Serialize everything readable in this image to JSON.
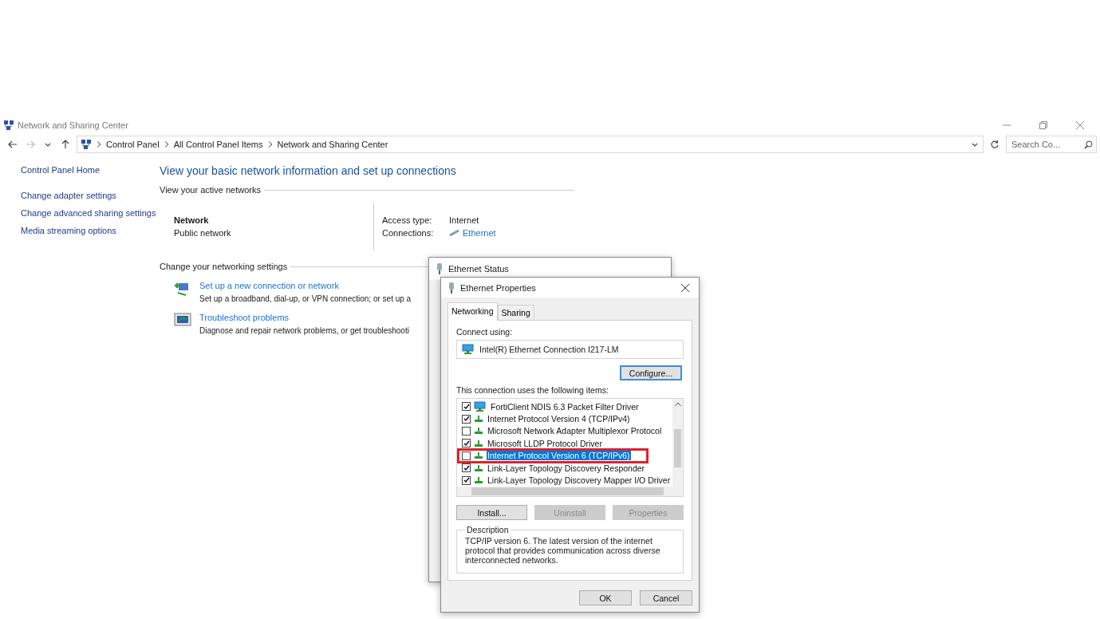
{
  "window": {
    "title": "Network and Sharing Center"
  },
  "address_bar": {
    "breadcrumbs": [
      "Control Panel",
      "All Control Panel Items",
      "Network and Sharing Center"
    ]
  },
  "search": {
    "placeholder": "Search Co..."
  },
  "sidebar": {
    "items": [
      "Control Panel Home",
      "Change adapter settings",
      "Change advanced sharing settings",
      "Media streaming options"
    ]
  },
  "heading": "View your basic network information and set up connections",
  "active_networks": {
    "title": "View your active networks",
    "network_name": "Network",
    "network_type": "Public network",
    "access_type_label": "Access type:",
    "access_type": "Internet",
    "connections_label": "Connections:",
    "connection": "Ethernet"
  },
  "settings": {
    "title": "Change your networking settings",
    "tasks": [
      {
        "kind": "new-connection",
        "title": "Set up a new connection or network",
        "description": "Set up a broadband, dial-up, or VPN connection; or set up a"
      },
      {
        "kind": "troubleshoot",
        "title": "Troubleshoot problems",
        "description": "Diagnose and repair network problems, or get troubleshooti"
      }
    ]
  },
  "status_dialog": {
    "title": "Ethernet Status"
  },
  "properties_dialog": {
    "title": "Ethernet Properties",
    "tabs": [
      {
        "label": "Networking",
        "selected": true
      },
      {
        "label": "Sharing",
        "selected": false
      }
    ],
    "connect_using_label": "Connect using:",
    "adapter": "Intel(R) Ethernet Connection I217-LM",
    "configure_button": "Configure...",
    "items_label": "This connection uses the following items:",
    "items": [
      {
        "kind": "client",
        "label": "FortiClient NDIS 6.3 Packet Filter Driver",
        "checked": true,
        "selected": false
      },
      {
        "kind": "protocol",
        "label": "Internet Protocol Version 4 (TCP/IPv4)",
        "checked": true,
        "selected": false
      },
      {
        "kind": "protocol",
        "label": "Microsoft Network Adapter Multiplexor Protocol",
        "checked": false,
        "selected": false
      },
      {
        "kind": "protocol",
        "label": "Microsoft LLDP Protocol Driver",
        "checked": true,
        "selected": false
      },
      {
        "kind": "protocol",
        "label": "Internet Protocol Version 6 (TCP/IPv6)",
        "checked": false,
        "selected": true
      },
      {
        "kind": "protocol",
        "label": "Link-Layer Topology Discovery Responder",
        "checked": true,
        "selected": false
      },
      {
        "kind": "protocol",
        "label": "Link-Layer Topology Discovery Mapper I/O Driver",
        "checked": true,
        "selected": false
      }
    ],
    "buttons": [
      {
        "label": "Install...",
        "disabled": false
      },
      {
        "label": "Uninstall",
        "disabled": true
      },
      {
        "label": "Properties",
        "disabled": true
      }
    ],
    "description_label": "Description",
    "description": "TCP/IP version 6. The latest version of the internet protocol that provides communication across diverse interconnected networks.",
    "footer_buttons": [
      "OK",
      "Cancel"
    ]
  }
}
